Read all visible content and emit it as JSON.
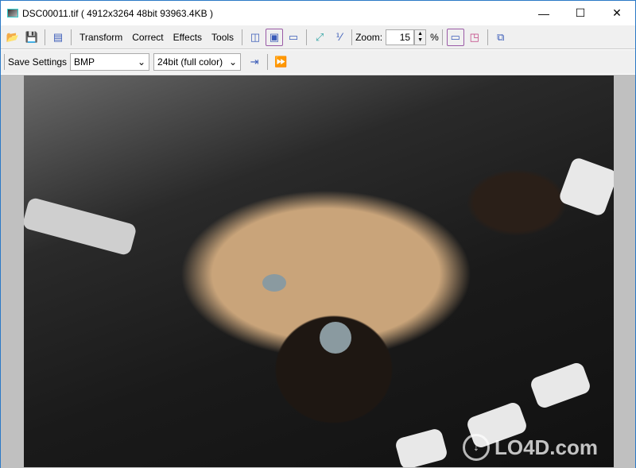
{
  "window": {
    "title": "DSC00011.tif  ( 4912x3264  48bit  93963.4KB )",
    "minimize": "—",
    "maximize": "☐",
    "close": "✕"
  },
  "toolbar": {
    "menus": [
      "Transform",
      "Correct",
      "Effects",
      "Tools"
    ],
    "zoom_label": "Zoom:",
    "zoom_value": "15",
    "zoom_unit": "%"
  },
  "save_bar": {
    "label": "Save Settings",
    "format": "BMP",
    "depth": "24bit (full color)"
  },
  "watermark": "LO4D.com",
  "colors": {
    "accent": "#3a5bb8",
    "selected_border": "#9a5aa6",
    "canvas_bg": "#c0c0c0"
  }
}
